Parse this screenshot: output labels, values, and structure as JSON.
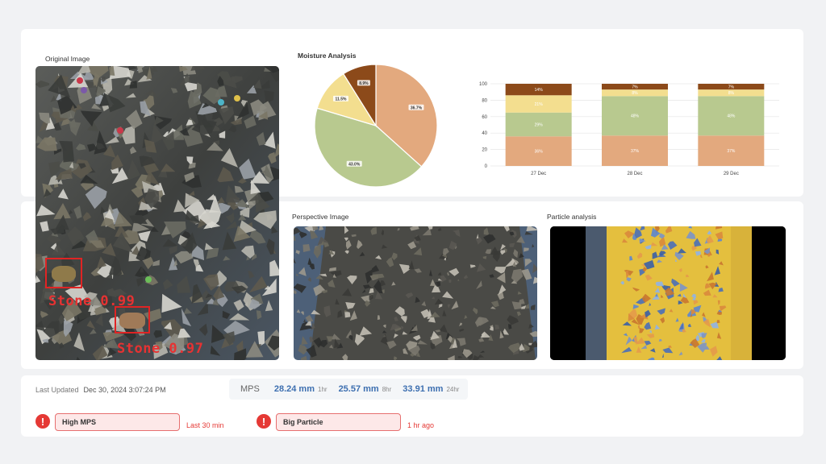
{
  "panels": {
    "original_image": "Original Image",
    "moisture_analysis": "Moisture Analysis",
    "perspective_image": "Perspective Image",
    "particle_analysis": "Particle analysis"
  },
  "detections": [
    {
      "label": "Stone 0.99"
    },
    {
      "label": "Stone 0.97"
    }
  ],
  "chart_data": [
    {
      "type": "pie",
      "title": "Moisture Analysis",
      "slices": [
        {
          "value": 36.7,
          "label": "36.7%",
          "color": "#e3a97e"
        },
        {
          "value": 43.0,
          "label": "43.0%",
          "color": "#b8c98f"
        },
        {
          "value": 11.5,
          "label": "11.5%",
          "color": "#f3de8f"
        },
        {
          "value": 8.9,
          "label": "8.9%",
          "color": "#8c4a1a"
        }
      ]
    },
    {
      "type": "bar",
      "stacked": true,
      "categories": [
        "27 Dec",
        "28 Dec",
        "29 Dec"
      ],
      "ylim": [
        0,
        100
      ],
      "yticks": [
        "0",
        "20",
        "40",
        "60",
        "80",
        "100"
      ],
      "series": [
        {
          "values": [
            36,
            37,
            37
          ],
          "labels": [
            "36%",
            "37%",
            "37%"
          ],
          "color": "#e3a97e"
        },
        {
          "values": [
            29,
            48,
            48
          ],
          "labels": [
            "29%",
            "48%",
            "48%"
          ],
          "color": "#b8c98f"
        },
        {
          "values": [
            21,
            8,
            8
          ],
          "labels": [
            "21%",
            "8%",
            "8%"
          ],
          "color": "#f3de8f"
        },
        {
          "values": [
            14,
            7,
            7
          ],
          "labels": [
            "14%",
            "7%",
            "7%"
          ],
          "color": "#8c4a1a"
        }
      ],
      "grid": true
    }
  ],
  "status": {
    "last_updated_label": "Last Updated",
    "last_updated_value": "Dec 30, 2024 3:07:24 PM"
  },
  "mps": {
    "title": "MPS",
    "readings": [
      {
        "value": "28.24 mm",
        "period": "1hr"
      },
      {
        "value": "25.57 mm",
        "period": "8hr"
      },
      {
        "value": "33.91 mm",
        "period": "24hr"
      }
    ]
  },
  "alerts": [
    {
      "icon": "!",
      "label": "High MPS",
      "time": "Last 30 min"
    },
    {
      "icon": "!",
      "label": "Big Particle",
      "time": "1 hr ago"
    }
  ],
  "colors": {
    "accent_blue": "#3d6fb0",
    "alert_red": "#e53935",
    "belt_yellow": "#e8c244"
  }
}
